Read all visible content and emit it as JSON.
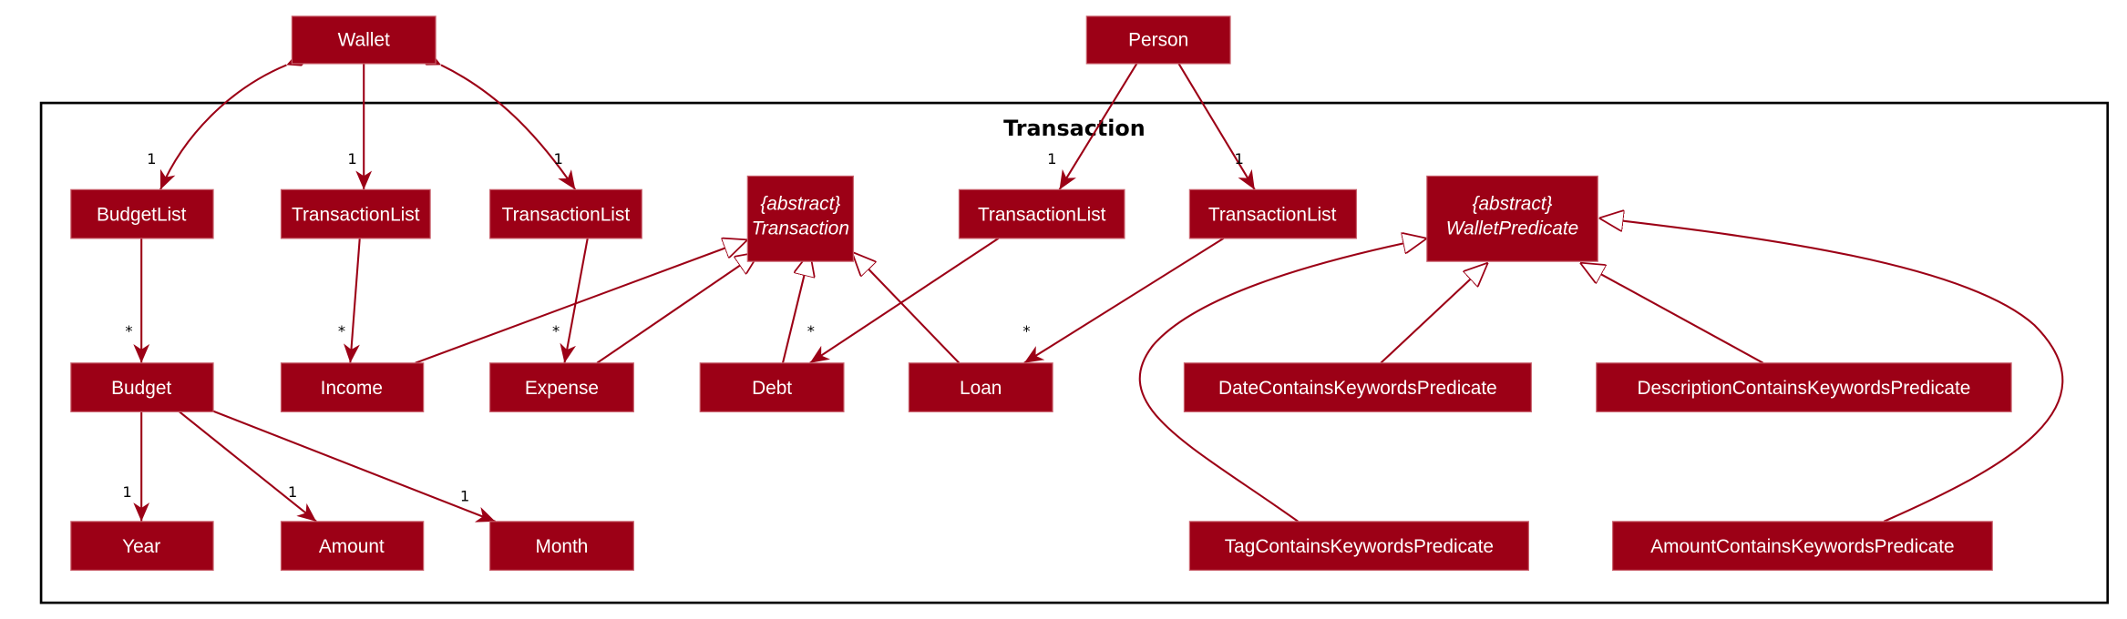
{
  "package": {
    "title": "Transaction"
  },
  "classes": {
    "wallet": "Wallet",
    "person": "Person",
    "budget_list": "BudgetList",
    "transaction_list_1": "TransactionList",
    "transaction_list_2": "TransactionList",
    "transaction_list_3": "TransactionList",
    "transaction_list_4": "TransactionList",
    "transaction": {
      "stereotype": "{abstract}",
      "name": "Transaction"
    },
    "wallet_predicate": {
      "stereotype": "{abstract}",
      "name": "WalletPredicate"
    },
    "budget": "Budget",
    "income": "Income",
    "expense": "Expense",
    "debt": "Debt",
    "loan": "Loan",
    "date_predicate": "DateContainsKeywordsPredicate",
    "description_predicate": "DescriptionContainsKeywordsPredicate",
    "year": "Year",
    "amount": "Amount",
    "month": "Month",
    "tag_predicate": "TagContainsKeywordsPredicate",
    "amount_predicate": "AmountContainsKeywordsPredicate"
  },
  "multiplicities": {
    "wallet_budgetlist": "1",
    "wallet_tl1": "1",
    "wallet_tl2": "1",
    "person_tl3": "1",
    "person_tl4": "1",
    "budgetlist_budget": "*",
    "tl1_income": "*",
    "tl2_expense": "*",
    "tl3_debt": "*",
    "tl4_loan": "*",
    "budget_year": "1",
    "budget_amount": "1",
    "budget_month": "1"
  },
  "colors": {
    "class_fill": "#9c0016",
    "edge": "#9c0016",
    "text": "#ffffff"
  }
}
